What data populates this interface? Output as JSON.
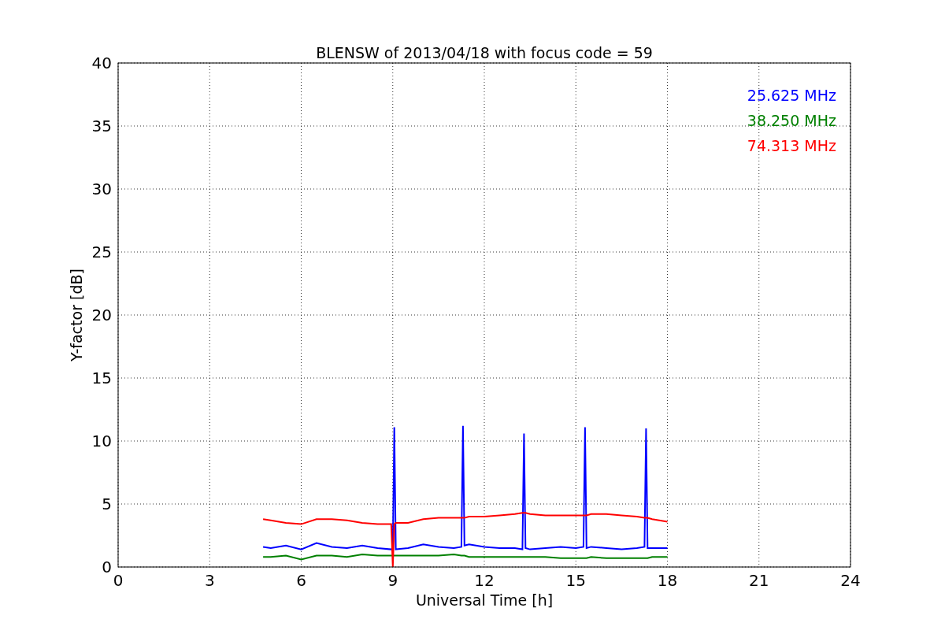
{
  "figure": {
    "chart_data": {
      "type": "line",
      "title": "BLENSW of 2013/04/18 with focus code = 59",
      "xlabel": "Universal Time [h]",
      "ylabel": "Y-factor [dB]",
      "x": [
        4.75,
        5,
        5.5,
        6,
        6.5,
        7,
        7.5,
        8,
        8.5,
        8.95,
        9.0,
        9.05,
        9.1,
        9.5,
        10,
        10.5,
        11,
        11.25,
        11.3,
        11.35,
        11.5,
        12,
        12.5,
        13,
        13.25,
        13.3,
        13.35,
        13.5,
        14,
        14.5,
        15,
        15.25,
        15.3,
        15.35,
        15.5,
        16,
        16.5,
        17,
        17.25,
        17.3,
        17.35,
        17.5,
        18
      ],
      "series": [
        {
          "name": "25.625 MHz",
          "color": "#0000ff",
          "values": [
            1.6,
            1.5,
            1.7,
            1.4,
            1.9,
            1.6,
            1.5,
            1.7,
            1.5,
            1.4,
            1.5,
            11.1,
            1.4,
            1.5,
            1.8,
            1.6,
            1.5,
            1.6,
            11.2,
            1.7,
            1.8,
            1.6,
            1.5,
            1.5,
            1.4,
            10.6,
            1.5,
            1.4,
            1.5,
            1.6,
            1.5,
            1.6,
            11.1,
            1.5,
            1.6,
            1.5,
            1.4,
            1.5,
            1.6,
            11.0,
            1.5,
            1.5,
            1.5
          ]
        },
        {
          "name": "38.250 MHz",
          "color": "#008000",
          "values": [
            0.8,
            0.8,
            0.9,
            0.6,
            0.9,
            0.9,
            0.8,
            1.0,
            0.9,
            0.9,
            0.9,
            0.9,
            0.9,
            0.9,
            0.9,
            0.9,
            1.0,
            0.9,
            0.9,
            0.9,
            0.8,
            0.8,
            0.8,
            0.8,
            0.8,
            0.8,
            0.8,
            0.8,
            0.8,
            0.7,
            0.7,
            0.7,
            0.7,
            0.7,
            0.8,
            0.7,
            0.7,
            0.7,
            0.7,
            0.7,
            0.7,
            0.8,
            0.8
          ]
        },
        {
          "name": "74.313 MHz",
          "color": "#ff0000",
          "values": [
            3.8,
            3.7,
            3.5,
            3.4,
            3.8,
            3.8,
            3.7,
            3.5,
            3.4,
            3.4,
            0.0,
            3.4,
            3.5,
            3.5,
            3.8,
            3.9,
            3.9,
            3.9,
            3.9,
            3.9,
            4.0,
            4.0,
            4.1,
            4.2,
            4.3,
            4.3,
            4.3,
            4.2,
            4.1,
            4.1,
            4.1,
            4.1,
            4.1,
            4.1,
            4.2,
            4.2,
            4.1,
            4.0,
            3.9,
            3.9,
            3.9,
            3.8,
            3.6
          ]
        }
      ],
      "grid": true,
      "xlim": [
        0,
        24
      ],
      "ylim": [
        0,
        40
      ],
      "xticks": [
        0,
        3,
        6,
        9,
        12,
        15,
        18,
        21,
        24
      ],
      "yticks": [
        0,
        5,
        10,
        15,
        20,
        25,
        30,
        35,
        40
      ]
    }
  }
}
